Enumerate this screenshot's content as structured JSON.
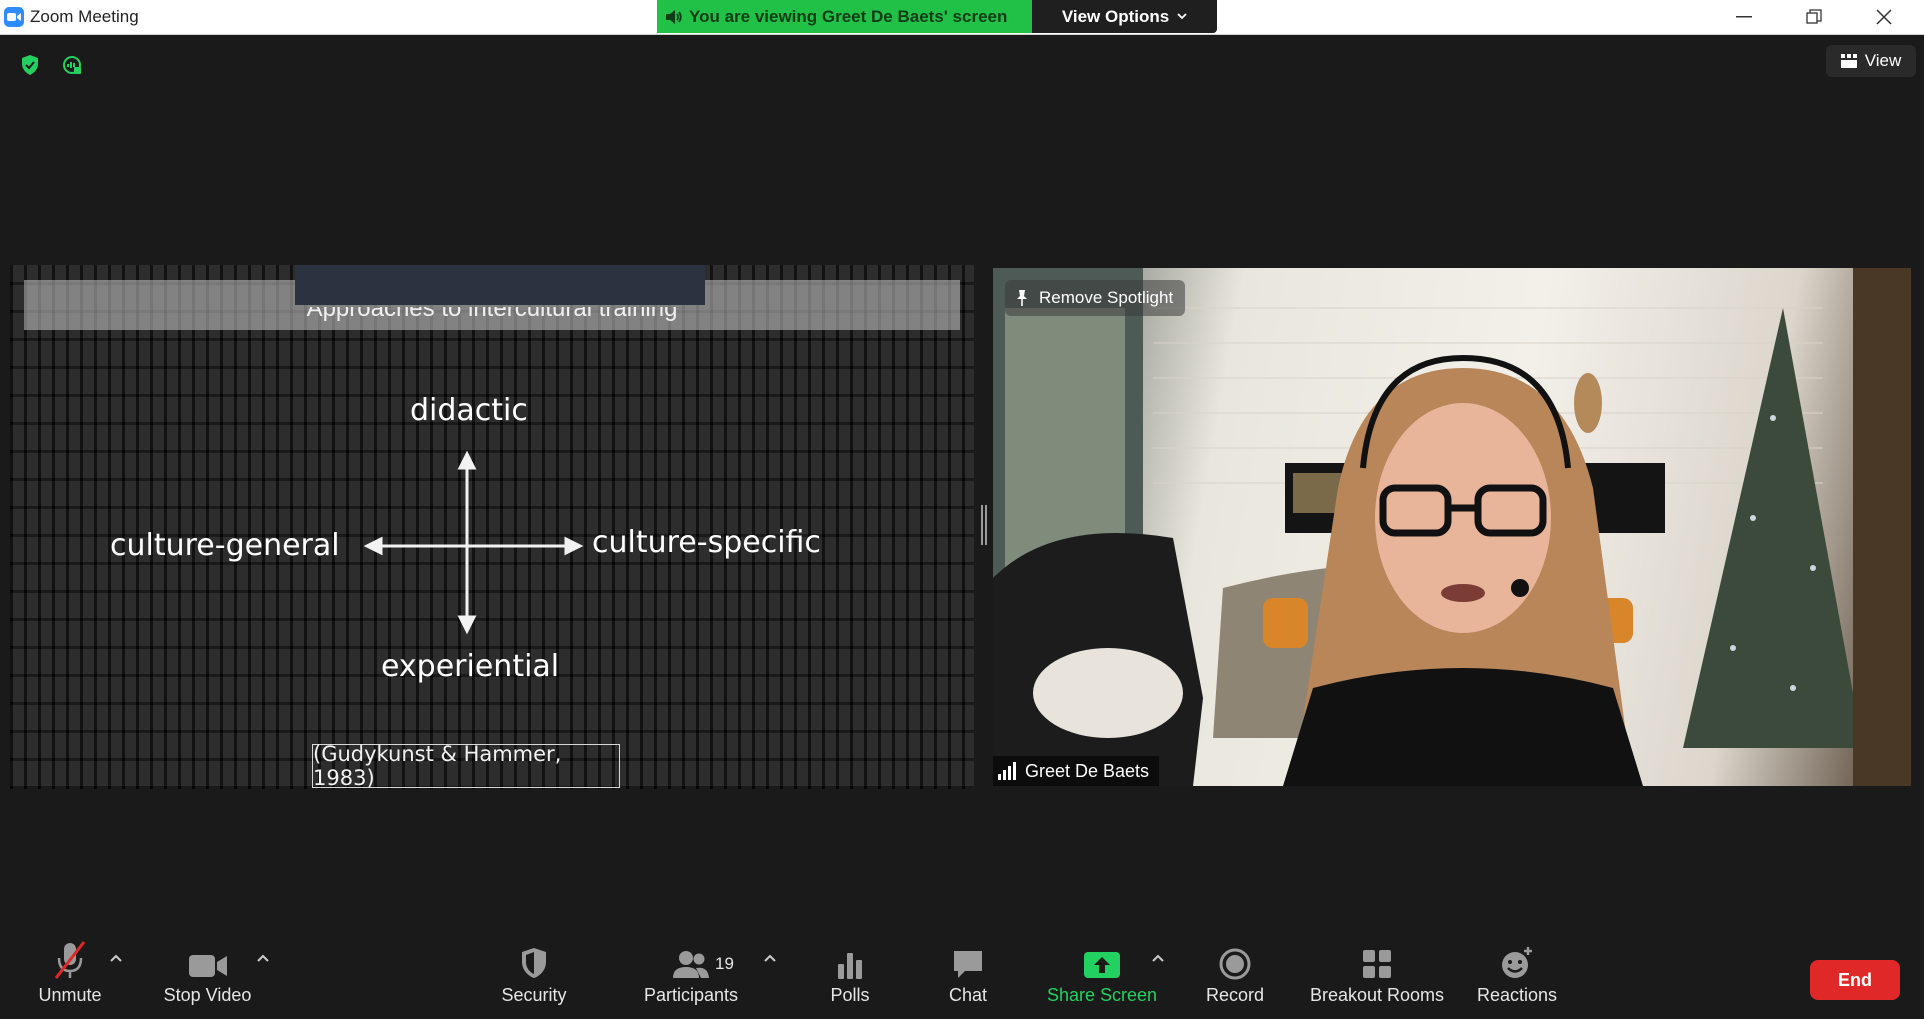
{
  "window": {
    "title": "Zoom Meeting",
    "banner_text": "You are viewing Greet De Baets' screen",
    "view_options_label": "View Options",
    "view_label": "View"
  },
  "shared_screen": {
    "slide_title": "Approaches to intercultural training",
    "top_label": "didactic",
    "left_label": "culture-general",
    "right_label": "culture-specific",
    "bottom_label": "experiential",
    "citation": "(Gudykunst & Hammer, 1983)"
  },
  "video": {
    "spotlight_label": "Remove Spotlight",
    "participant_name": "Greet De Baets"
  },
  "toolbar": {
    "unmute": "Unmute",
    "stop_video": "Stop Video",
    "security": "Security",
    "participants": "Participants",
    "participants_count": "19",
    "polls": "Polls",
    "chat": "Chat",
    "share_screen": "Share Screen",
    "record": "Record",
    "breakout_rooms": "Breakout Rooms",
    "reactions": "Reactions",
    "end": "End"
  },
  "colors": {
    "share_green": "#21c147",
    "end_red": "#e02828",
    "zoom_blue": "#2d8cff"
  }
}
